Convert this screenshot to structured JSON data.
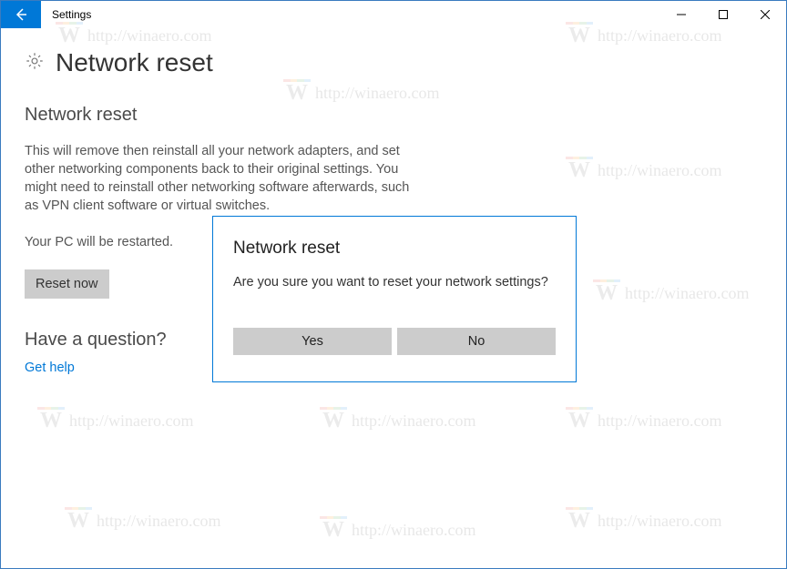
{
  "window": {
    "title": "Settings"
  },
  "page": {
    "title": "Network reset",
    "section_title": "Network reset",
    "description": "This will remove then reinstall all your network adapters, and set other networking components back to their original settings. You might need to reinstall other networking software afterwards, such as VPN client software or virtual switches.",
    "restart_note": "Your PC will be restarted.",
    "reset_button": "Reset now",
    "question_title": "Have a question?",
    "help_link": "Get help"
  },
  "dialog": {
    "title": "Network reset",
    "message": "Are you sure you want to reset your network settings?",
    "yes": "Yes",
    "no": "No"
  },
  "watermark": {
    "text": "http://winaero.com"
  }
}
